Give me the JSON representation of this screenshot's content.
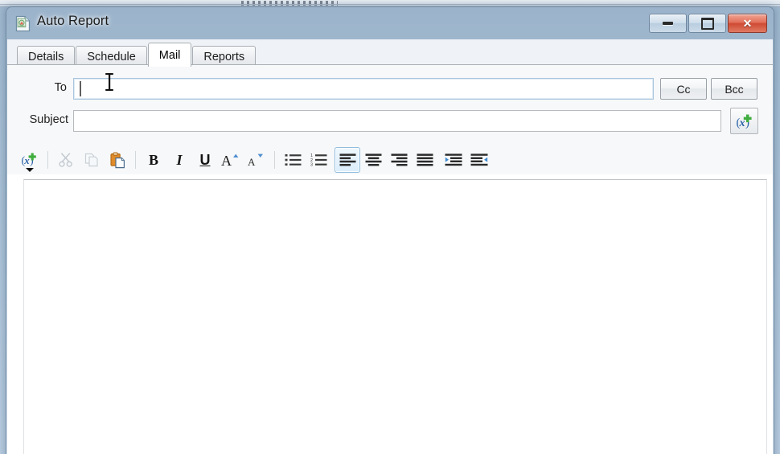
{
  "window": {
    "title": "Auto Report",
    "icon": "report-document-icon",
    "controls": {
      "minimize": "Minimize",
      "maximize": "Maximize",
      "close": "Close"
    }
  },
  "tabs": [
    {
      "label": "Details",
      "active": false
    },
    {
      "label": "Schedule",
      "active": false
    },
    {
      "label": "Mail",
      "active": true
    },
    {
      "label": "Reports",
      "active": false
    }
  ],
  "mail": {
    "to": {
      "label": "To",
      "value": "",
      "placeholder": "",
      "focused": true
    },
    "cc_label": "Cc",
    "bcc_label": "Bcc",
    "subject": {
      "label": "Subject",
      "value": "",
      "placeholder": ""
    },
    "subject_variable_button": "insert-variable-icon",
    "body": {
      "value": ""
    }
  },
  "toolbar": {
    "items": [
      {
        "name": "insert-variable-dropdown",
        "glyph": "(x)+",
        "state": "normal"
      },
      {
        "name": "cut",
        "glyph": "scissors",
        "state": "disabled"
      },
      {
        "name": "copy",
        "glyph": "copy-pages",
        "state": "disabled"
      },
      {
        "name": "paste",
        "glyph": "clipboard",
        "state": "normal"
      },
      {
        "name": "bold",
        "glyph": "B",
        "state": "normal"
      },
      {
        "name": "italic",
        "glyph": "I",
        "state": "normal"
      },
      {
        "name": "underline",
        "glyph": "U",
        "state": "normal"
      },
      {
        "name": "grow-font",
        "glyph": "A▲",
        "state": "normal"
      },
      {
        "name": "shrink-font",
        "glyph": "A▼",
        "state": "normal"
      },
      {
        "name": "bullet-list",
        "glyph": "bullets",
        "state": "normal"
      },
      {
        "name": "numbered-list",
        "glyph": "numbers",
        "state": "normal"
      },
      {
        "name": "align-left",
        "glyph": "align-left",
        "state": "selected"
      },
      {
        "name": "align-center",
        "glyph": "align-center",
        "state": "normal"
      },
      {
        "name": "align-right",
        "glyph": "align-right",
        "state": "normal"
      },
      {
        "name": "align-justify",
        "glyph": "align-justify",
        "state": "normal"
      },
      {
        "name": "indent",
        "glyph": "indent",
        "state": "normal"
      },
      {
        "name": "outdent",
        "glyph": "outdent",
        "state": "normal"
      }
    ]
  },
  "colors": {
    "titlebar_top": "#9cb4cb",
    "titlebar_bottom": "#d7e4ef",
    "close_button": "#cf4a33",
    "accent_selected": "#8fbcdd",
    "panel_bg": "#f7f8f9",
    "editor_bg": "#ffffff",
    "paste_orange": "#e08b2a",
    "variable_green": "#3fae3f",
    "variable_blue": "#2a63a8"
  }
}
